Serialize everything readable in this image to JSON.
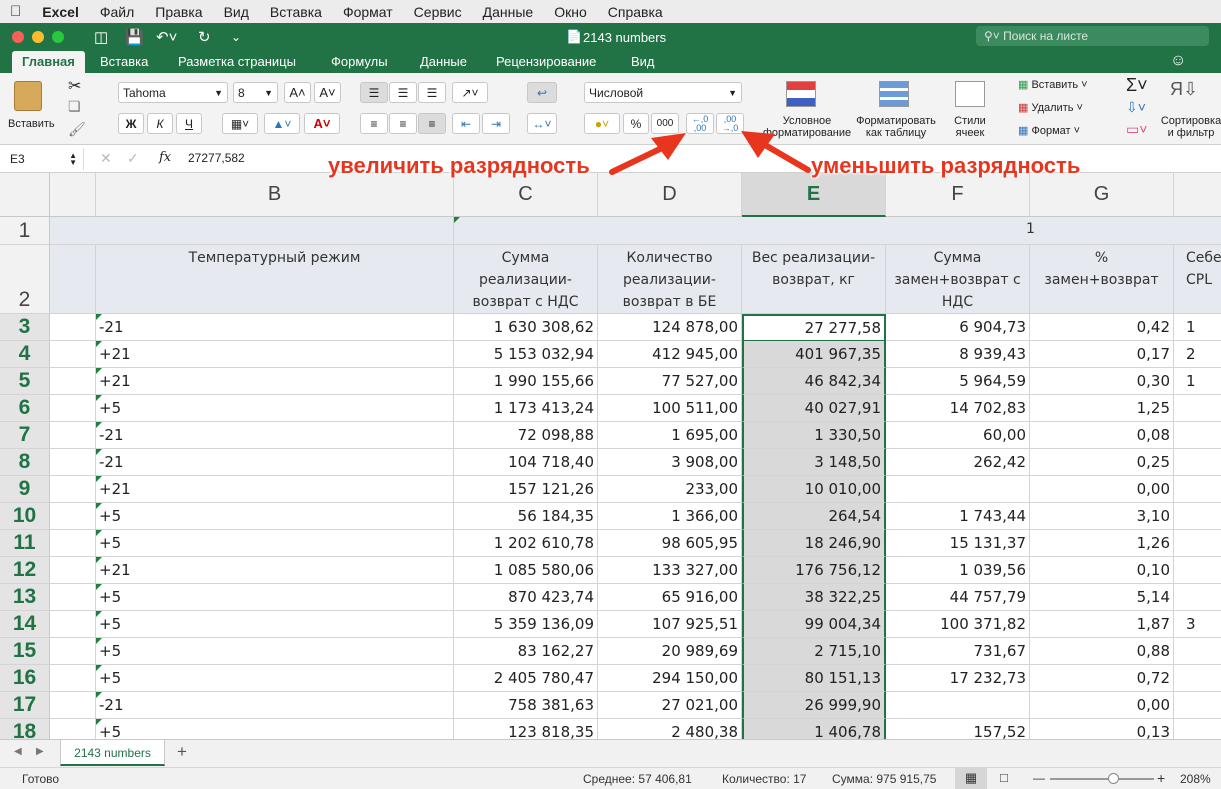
{
  "menubar": {
    "app": "Excel",
    "items": [
      "Файл",
      "Правка",
      "Вид",
      "Вставка",
      "Формат",
      "Сервис",
      "Данные",
      "Окно",
      "Справка"
    ]
  },
  "titlebar": {
    "doc_title": "2143 numbers",
    "search_placeholder": "Поиск на листе",
    "accent": "#217346"
  },
  "ribbon_tabs": [
    "Главная",
    "Вставка",
    "Разметка страницы",
    "Формулы",
    "Данные",
    "Рецензирование",
    "Вид"
  ],
  "ribbon": {
    "paste_label": "Вставить",
    "font_name": "Tahoma",
    "font_size": "8",
    "bold": "Ж",
    "italic": "К",
    "underline": "Ч",
    "number_format": "Числовой",
    "percent": "%",
    "thousands": "000",
    "increase_decimal": "←,0 ,00",
    "decrease_decimal": ",00 →,0",
    "cond_format": "Условное форматирование",
    "format_table": "Форматировать как таблицу",
    "cell_styles": "Стили ячеек",
    "insert": "Вставить",
    "delete": "Удалить",
    "format": "Формат",
    "sort_filter": "Сортировка и фильтр"
  },
  "formula_bar": {
    "name_box": "E3",
    "fx": "fx",
    "value": "27277,582"
  },
  "callouts": {
    "increase": "увеличить разрядность",
    "decrease": "уменьшить разрядность",
    "color": "#e8361e"
  },
  "grid": {
    "columns": [
      {
        "name": "",
        "id": "col-a"
      },
      {
        "name": "B",
        "id": "col-b"
      },
      {
        "name": "C",
        "id": "col-c"
      },
      {
        "name": "D",
        "id": "col-d"
      },
      {
        "name": "E",
        "id": "col-e",
        "selected": true
      },
      {
        "name": "F",
        "id": "col-f"
      },
      {
        "name": "G",
        "id": "col-g"
      },
      {
        "name": "",
        "id": "col-h"
      }
    ],
    "row1_label": "1",
    "row1_value": "1",
    "row2_label": "2",
    "headers": {
      "b": "Температурный режим",
      "c": "Сумма реализации-возврат с НДС",
      "d": "Количество реализации-возврат в БЕ",
      "e": "Вес реализации-возврат, кг",
      "f": "Сумма замен+возврат с НДС",
      "g": "% замен+возврат",
      "h": "Себе CPL"
    },
    "rows": [
      {
        "n": "3",
        "b": "-21",
        "c": "1 630 308,62",
        "d": "124 878,00",
        "e": "27 277,58",
        "f": "6 904,73",
        "g": "0,42",
        "h": "1"
      },
      {
        "n": "4",
        "b": "+21",
        "c": "5 153 032,94",
        "d": "412 945,00",
        "e": "401 967,35",
        "f": "8 939,43",
        "g": "0,17",
        "h": "2"
      },
      {
        "n": "5",
        "b": "+21",
        "c": "1 990 155,66",
        "d": "77 527,00",
        "e": "46 842,34",
        "f": "5 964,59",
        "g": "0,30",
        "h": "1"
      },
      {
        "n": "6",
        "b": "+5",
        "c": "1 173 413,24",
        "d": "100 511,00",
        "e": "40 027,91",
        "f": "14 702,83",
        "g": "1,25",
        "h": ""
      },
      {
        "n": "7",
        "b": "-21",
        "c": "72 098,88",
        "d": "1 695,00",
        "e": "1 330,50",
        "f": "60,00",
        "g": "0,08",
        "h": ""
      },
      {
        "n": "8",
        "b": "-21",
        "c": "104 718,40",
        "d": "3 908,00",
        "e": "3 148,50",
        "f": "262,42",
        "g": "0,25",
        "h": ""
      },
      {
        "n": "9",
        "b": "+21",
        "c": "157 121,26",
        "d": "233,00",
        "e": "10 010,00",
        "f": "",
        "g": "0,00",
        "h": ""
      },
      {
        "n": "10",
        "b": "+5",
        "c": "56 184,35",
        "d": "1 366,00",
        "e": "264,54",
        "f": "1 743,44",
        "g": "3,10",
        "h": ""
      },
      {
        "n": "11",
        "b": "+5",
        "c": "1 202 610,78",
        "d": "98 605,95",
        "e": "18 246,90",
        "f": "15 131,37",
        "g": "1,26",
        "h": ""
      },
      {
        "n": "12",
        "b": "+21",
        "c": "1 085 580,06",
        "d": "133 327,00",
        "e": "176 756,12",
        "f": "1 039,56",
        "g": "0,10",
        "h": ""
      },
      {
        "n": "13",
        "b": "+5",
        "c": "870 423,74",
        "d": "65 916,00",
        "e": "38 322,25",
        "f": "44 757,79",
        "g": "5,14",
        "h": ""
      },
      {
        "n": "14",
        "b": "+5",
        "c": "5 359 136,09",
        "d": "107 925,51",
        "e": "99 004,34",
        "f": "100 371,82",
        "g": "1,87",
        "h": "3"
      },
      {
        "n": "15",
        "b": "+5",
        "c": "83 162,27",
        "d": "20 989,69",
        "e": "2 715,10",
        "f": "731,67",
        "g": "0,88",
        "h": ""
      },
      {
        "n": "16",
        "b": "+5",
        "c": "2 405 780,47",
        "d": "294 150,00",
        "e": "80 151,13",
        "f": "17 232,73",
        "g": "0,72",
        "h": ""
      },
      {
        "n": "17",
        "b": "-21",
        "c": "758 381,63",
        "d": "27 021,00",
        "e": "26 999,90",
        "f": "",
        "g": "0,00",
        "h": ""
      },
      {
        "n": "18",
        "b": "+5",
        "c": "123 818,35",
        "d": "2 480,38",
        "e": "1 406,78",
        "f": "157,52",
        "g": "0,13",
        "h": ""
      }
    ]
  },
  "sheet_tabs": {
    "active": "2143 numbers",
    "add": "+"
  },
  "status": {
    "ready": "Готово",
    "avg": "Среднее: 57 406,81",
    "count": "Количество: 17",
    "sum": "Сумма: 975 915,75",
    "zoom": "208%"
  }
}
